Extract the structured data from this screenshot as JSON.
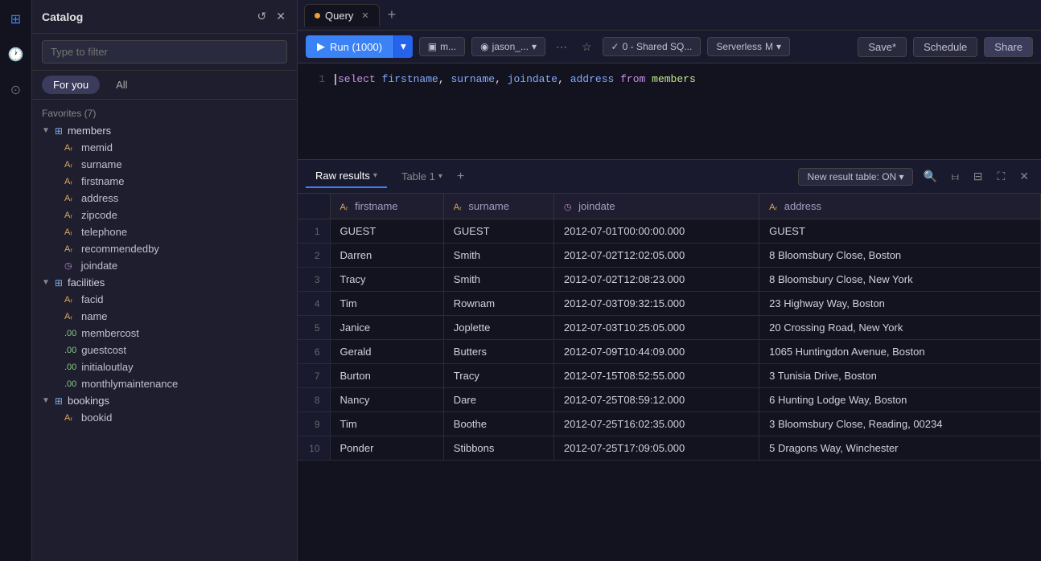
{
  "sidebar": {
    "title": "Catalog",
    "search_placeholder": "Type to filter",
    "tabs": [
      {
        "label": "For you",
        "active": true
      },
      {
        "label": "All",
        "active": false
      }
    ],
    "favorites_label": "Favorites (7)",
    "tree": {
      "members": {
        "label": "members",
        "columns": [
          {
            "name": "memid",
            "type": "string"
          },
          {
            "name": "surname",
            "type": "string"
          },
          {
            "name": "firstname",
            "type": "string"
          },
          {
            "name": "address",
            "type": "string"
          },
          {
            "name": "zipcode",
            "type": "string"
          },
          {
            "name": "telephone",
            "type": "string"
          },
          {
            "name": "recommendedby",
            "type": "string"
          },
          {
            "name": "joindate",
            "type": "date"
          }
        ]
      },
      "facilities": {
        "label": "facilities",
        "columns": [
          {
            "name": "facid",
            "type": "string"
          },
          {
            "name": "name",
            "type": "string"
          },
          {
            "name": "membercost",
            "type": "number"
          },
          {
            "name": "guestcost",
            "type": "number"
          },
          {
            "name": "initialoutlay",
            "type": "number"
          },
          {
            "name": "monthlymaintenance",
            "type": "number"
          }
        ]
      },
      "bookings": {
        "label": "bookings",
        "columns": [
          {
            "name": "bookid",
            "type": "string"
          }
        ]
      }
    }
  },
  "query_tab": {
    "label": "Query",
    "dot_color": "#f0a030"
  },
  "toolbar": {
    "run_label": "Run (1000)",
    "source1": "m...",
    "source2": "jason_...",
    "status": "0 - Shared SQ...",
    "serverless": "Serverless",
    "mode": "M",
    "save_label": "Save*",
    "schedule_label": "Schedule",
    "share_label": "Share"
  },
  "editor": {
    "line1": "select firstname, surname, joindate, address from members"
  },
  "results": {
    "tabs": [
      {
        "label": "Raw results",
        "active": true
      },
      {
        "label": "Table 1",
        "active": false
      }
    ],
    "new_result_label": "New result table: ON",
    "columns": [
      {
        "name": "firstname",
        "type": "string"
      },
      {
        "name": "surname",
        "type": "string"
      },
      {
        "name": "joindate",
        "type": "date"
      },
      {
        "name": "address",
        "type": "string"
      }
    ],
    "rows": [
      {
        "num": 1,
        "firstname": "GUEST",
        "surname": "GUEST",
        "joindate": "2012-07-01T00:00:00.000",
        "address": "GUEST"
      },
      {
        "num": 2,
        "firstname": "Darren",
        "surname": "Smith",
        "joindate": "2012-07-02T12:02:05.000",
        "address": "8 Bloomsbury Close, Boston"
      },
      {
        "num": 3,
        "firstname": "Tracy",
        "surname": "Smith",
        "joindate": "2012-07-02T12:08:23.000",
        "address": "8 Bloomsbury Close, New York"
      },
      {
        "num": 4,
        "firstname": "Tim",
        "surname": "Rownam",
        "joindate": "2012-07-03T09:32:15.000",
        "address": "23 Highway Way, Boston"
      },
      {
        "num": 5,
        "firstname": "Janice",
        "surname": "Joplette",
        "joindate": "2012-07-03T10:25:05.000",
        "address": "20 Crossing Road, New York"
      },
      {
        "num": 6,
        "firstname": "Gerald",
        "surname": "Butters",
        "joindate": "2012-07-09T10:44:09.000",
        "address": "1065 Huntingdon Avenue, Boston"
      },
      {
        "num": 7,
        "firstname": "Burton",
        "surname": "Tracy",
        "joindate": "2012-07-15T08:52:55.000",
        "address": "3 Tunisia Drive, Boston"
      },
      {
        "num": 8,
        "firstname": "Nancy",
        "surname": "Dare",
        "joindate": "2012-07-25T08:59:12.000",
        "address": "6 Hunting Lodge Way, Boston"
      },
      {
        "num": 9,
        "firstname": "Tim",
        "surname": "Boothe",
        "joindate": "2012-07-25T16:02:35.000",
        "address": "3 Bloomsbury Close, Reading, 00234"
      },
      {
        "num": 10,
        "firstname": "Ponder",
        "surname": "Stibbons",
        "joindate": "2012-07-25T17:09:05.000",
        "address": "5 Dragons Way, Winchester"
      }
    ]
  }
}
